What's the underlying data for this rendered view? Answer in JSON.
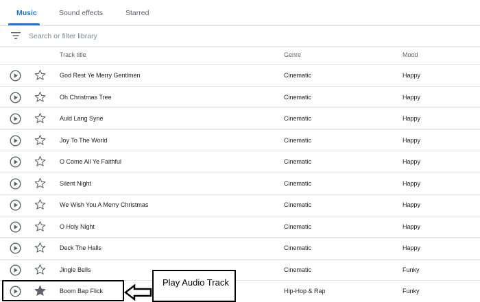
{
  "tabs": [
    {
      "label": "Music",
      "active": true
    },
    {
      "label": "Sound effects",
      "active": false
    },
    {
      "label": "Starred",
      "active": false
    }
  ],
  "search": {
    "placeholder": "Search or filter library",
    "value": ""
  },
  "table": {
    "columns": [
      "Track title",
      "Genre",
      "Mood"
    ],
    "rows": [
      {
        "title": "God Rest Ye Merry Gentlmen",
        "genre": "Cinematic",
        "mood": "Happy",
        "starred": false
      },
      {
        "title": "Oh Christmas Tree",
        "genre": "Cinematic",
        "mood": "Happy",
        "starred": false
      },
      {
        "title": "Auld Lang Syne",
        "genre": "Cinematic",
        "mood": "Happy",
        "starred": false
      },
      {
        "title": "Joy To The World",
        "genre": "Cinematic",
        "mood": "Happy",
        "starred": false
      },
      {
        "title": "O Come All Ye Faithful",
        "genre": "Cinematic",
        "mood": "Happy",
        "starred": false
      },
      {
        "title": "Silent Night",
        "genre": "Cinematic",
        "mood": "Happy",
        "starred": false
      },
      {
        "title": "We Wish You A Merry Christmas",
        "genre": "Cinematic",
        "mood": "Happy",
        "starred": false
      },
      {
        "title": "O Holy Night",
        "genre": "Cinematic",
        "mood": "Happy",
        "starred": false
      },
      {
        "title": "Deck The Halls",
        "genre": "Cinematic",
        "mood": "Happy",
        "starred": false
      },
      {
        "title": "Jingle Bells",
        "genre": "Cinematic",
        "mood": "Funky",
        "starred": false
      },
      {
        "title": "Boom Bap Flick",
        "genre": "Hip-Hop & Rap",
        "mood": "Funky",
        "starred": true
      }
    ]
  },
  "annotation": {
    "text": "Play Audio Track"
  },
  "colors": {
    "accent": "#1a73e8",
    "divider": "#e0e0e0",
    "icon": "#5f6368"
  },
  "icons": {
    "play": "play-circle-icon",
    "star": "star-icon",
    "filter": "filter-list-icon",
    "arrow": "arrow-left-icon"
  }
}
